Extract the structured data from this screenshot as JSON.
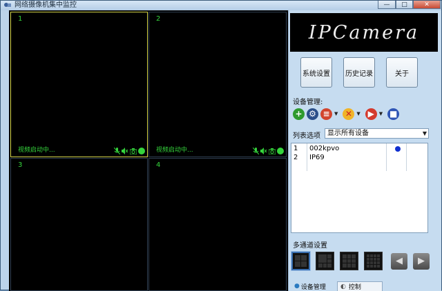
{
  "window": {
    "title": "网络摄像机集中监控",
    "minimize_glyph": "—",
    "maximize_glyph": "□",
    "close_glyph": "✕"
  },
  "video": {
    "cells": [
      {
        "number": "1",
        "status": "视频启动中..."
      },
      {
        "number": "2",
        "status": "视频启动中..."
      },
      {
        "number": "3",
        "status": ""
      },
      {
        "number": "4",
        "status": ""
      }
    ],
    "cell_icons": [
      "mic-muted-icon",
      "speaker-muted-icon",
      "camera-icon",
      "record-dot-icon"
    ]
  },
  "panel": {
    "logo_text": "IPCamera",
    "buttons": {
      "system_settings": "系统设置",
      "history": "历史记录",
      "about": "关于"
    },
    "device_mgmt_label": "设备管理:",
    "toolbar_icons": [
      "add-icon",
      "search-device-icon",
      "edit-icon",
      "delete-icon",
      "play-icon",
      "stop-icon"
    ],
    "list_option_label": "列表选项",
    "list_option_value": "显示所有设备",
    "devices": [
      {
        "index": "1",
        "name": "002kpvo",
        "online": true
      },
      {
        "index": "2",
        "name": "IP69",
        "online": false
      }
    ],
    "multichannel_label": "多通道设置",
    "tabs": {
      "device_management": "设备管理",
      "control": "控制"
    }
  },
  "colors": {
    "overlay_text": "#35d43c",
    "active_border": "#d6d64a",
    "online_dot": "#1030d0"
  }
}
